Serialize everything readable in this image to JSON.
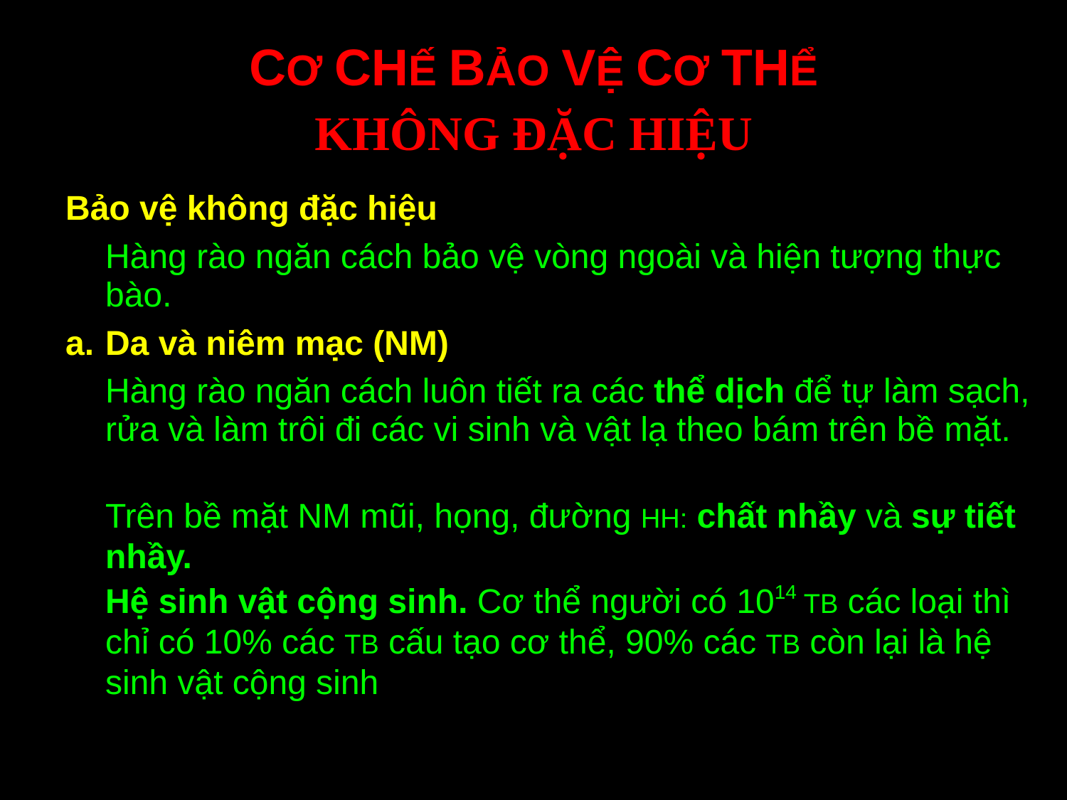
{
  "title": {
    "line1_parts": [
      {
        "text": "C",
        "small": false
      },
      {
        "text": "Ơ ",
        "small": true
      },
      {
        "text": "CH",
        "small": false
      },
      {
        "text": "Ế ",
        "small": true
      },
      {
        "text": "B",
        "small": false
      },
      {
        "text": "ẢO ",
        "small": true
      },
      {
        "text": "V",
        "small": false
      },
      {
        "text": "Ệ ",
        "small": true
      },
      {
        "text": "C",
        "small": false
      },
      {
        "text": "Ơ ",
        "small": true
      },
      {
        "text": "TH",
        "small": false
      },
      {
        "text": "Ể",
        "small": true
      }
    ],
    "line2": "KHÔNG ĐẶC HIỆU"
  },
  "heading": "Bảo vệ không đặc hiệu",
  "intro": "Hàng rào ngăn cách bảo vệ vòng ngoài và hiện tượng thực bào.",
  "section_a": {
    "marker": "a.",
    "title": "Da và niêm mạc (NM)"
  },
  "para1": {
    "before": "Hàng rào ngăn cách luôn tiết ra các ",
    "bold": "thể dịch",
    "after": " để tự làm sạch, rửa và làm trôi đi các vi sinh và vật lạ theo bám trên bề mặt."
  },
  "para2": {
    "before": "Trên bề mặt NM mũi, họng, đường ",
    "small": "HH:",
    "bold1": " chất nhầy",
    "middle": " và ",
    "bold2": "sự tiết nhầy."
  },
  "para3": {
    "bold": "Hệ sinh vật cộng sinh.",
    "text1": " Cơ thể người có 10",
    "sup": "14",
    "small1": " TB",
    "text2": " các loại thì chỉ có 10% các ",
    "small2": "TB",
    "text3": " cấu tạo cơ thể, 90% các ",
    "small3": "TB",
    "text4": " còn lại là hệ sinh vật cộng sinh"
  },
  "colors": {
    "background": "#000000",
    "title": "#ff0000",
    "heading": "#ffff00",
    "body": "#00ff00"
  }
}
